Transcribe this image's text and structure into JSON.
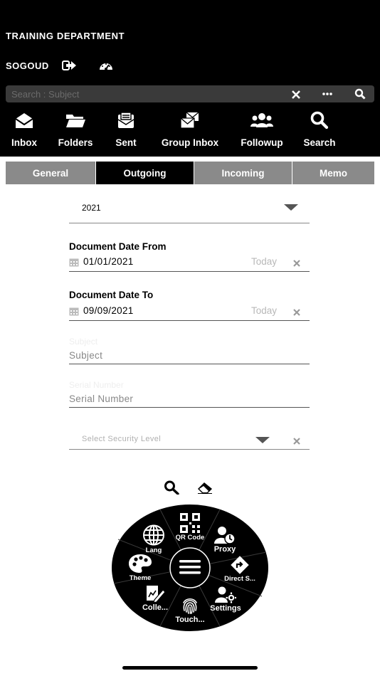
{
  "header": {
    "department": "TRAINING DEPARTMENT",
    "user": "SOGOUD",
    "icons": [
      "logout-icon",
      "dashboard-icon"
    ]
  },
  "search": {
    "placeholder": "Search : Subject",
    "icons": [
      "clear-icon",
      "more-icon",
      "search-icon"
    ]
  },
  "nav": [
    {
      "label": "Inbox",
      "icon": "inbox-icon"
    },
    {
      "label": "Folders",
      "icon": "folders-icon"
    },
    {
      "label": "Sent",
      "icon": "sent-icon"
    },
    {
      "label": "Group Inbox",
      "icon": "group-inbox-icon"
    },
    {
      "label": "Followup",
      "icon": "followup-icon"
    },
    {
      "label": "Search",
      "icon": "search-icon"
    }
  ],
  "tabs": [
    {
      "label": "General",
      "active": false
    },
    {
      "label": "Outgoing",
      "active": true
    },
    {
      "label": "Incoming",
      "active": false
    },
    {
      "label": "Memo",
      "active": false
    }
  ],
  "form": {
    "year": "2021",
    "date_from": {
      "label": "Document Date From",
      "value": "01/01/2021",
      "today": "Today"
    },
    "date_to": {
      "label": "Document Date To",
      "value": "09/09/2021",
      "today": "Today"
    },
    "subject": {
      "label": "Subject",
      "placeholder": "Subject"
    },
    "serial": {
      "label": "Serial Number",
      "placeholder": "Serial Number"
    },
    "security": {
      "placeholder": "Select Security Level"
    }
  },
  "wheel": {
    "items": [
      {
        "label": "QR Code",
        "icon": "qr-code-icon"
      },
      {
        "label": "Proxy",
        "icon": "proxy-icon"
      },
      {
        "label": "Direct S...",
        "icon": "direct-send-icon"
      },
      {
        "label": "Settings",
        "icon": "settings-icon"
      },
      {
        "label": "Touch...",
        "icon": "fingerprint-icon"
      },
      {
        "label": "Colle...",
        "icon": "collect-icon"
      },
      {
        "label": "Theme",
        "icon": "palette-icon"
      },
      {
        "label": "Lang",
        "icon": "globe-icon"
      }
    ],
    "center_icon": "menu-icon"
  },
  "colors": {
    "header_bg": "#000000",
    "tab_inactive": "#8a8a8a",
    "tab_active": "#000000",
    "search_bg": "#3a3a3a"
  }
}
